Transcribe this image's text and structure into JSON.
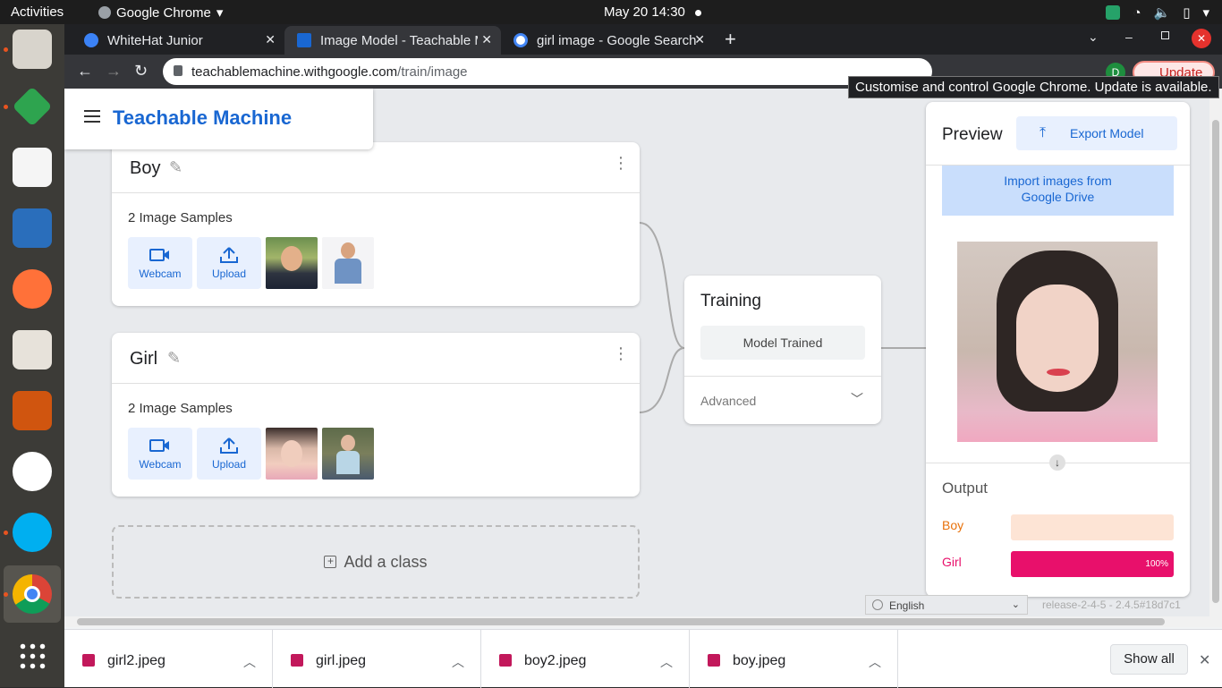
{
  "topbar": {
    "activities": "Activities",
    "app": "Google Chrome",
    "clock": "May 20  14:30"
  },
  "tabs": [
    {
      "title": "WhiteHat Junior"
    },
    {
      "title": "Image Model - Teachable M"
    },
    {
      "title": "girl image - Google Search"
    }
  ],
  "toolbar": {
    "url_host": "teachablemachine.withgoogle.com",
    "url_path": "/train/image",
    "avatar": "D",
    "update_label": "Update",
    "tooltip": "Customise and control Google Chrome. Update is available."
  },
  "app": {
    "title": "Teachable Machine",
    "classes": [
      {
        "name": "Boy",
        "samples": "2 Image Samples",
        "webcam": "Webcam",
        "upload": "Upload"
      },
      {
        "name": "Girl",
        "samples": "2 Image Samples",
        "webcam": "Webcam",
        "upload": "Upload"
      }
    ],
    "add_class": "Add a class",
    "training": {
      "title": "Training",
      "button": "Model Trained",
      "advanced": "Advanced"
    },
    "preview": {
      "title": "Preview",
      "export": "Export Model",
      "drive": "Import images from Google Drive",
      "output_title": "Output",
      "outputs": [
        {
          "label": "Boy",
          "fraction": 0.0,
          "percent_text": "",
          "color": "#e8710a",
          "bg": "#fde4d5"
        },
        {
          "label": "Girl",
          "fraction": 1.0,
          "percent_text": "100%",
          "color": "#e8106b",
          "bg": "#fce0ec"
        }
      ]
    },
    "language": "English",
    "release": "release-2-4-5 - 2.4.5#18d7c1"
  },
  "downloads": [
    {
      "file": "girl2.jpeg"
    },
    {
      "file": "girl.jpeg"
    },
    {
      "file": "boy2.jpeg"
    },
    {
      "file": "boy.jpeg"
    }
  ],
  "downloads_bar": {
    "show_all": "Show all"
  }
}
